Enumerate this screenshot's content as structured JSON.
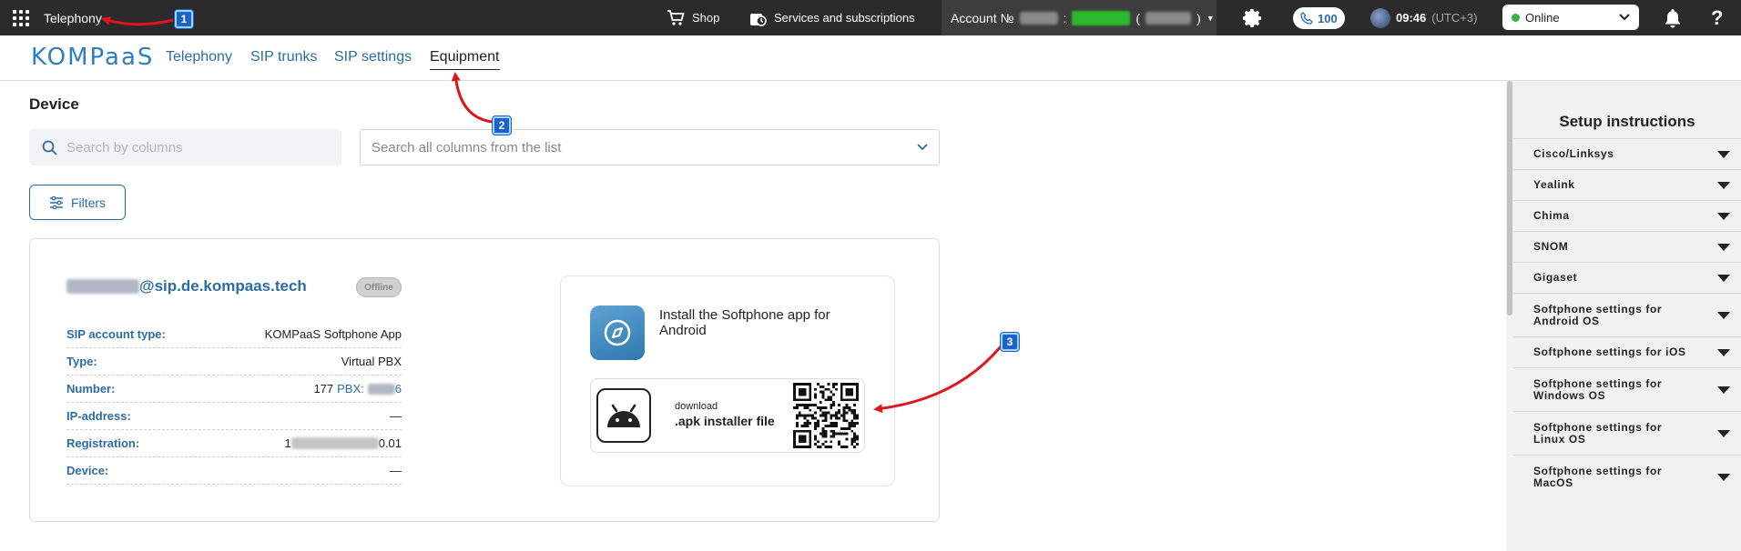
{
  "topbar": {
    "title": "Telephony",
    "shop_label": "Shop",
    "services_label": "Services and subscriptions",
    "account_prefix": "Account №",
    "account_sep": ":",
    "account_paren_open": "(",
    "account_paren_close": ")",
    "calls_count": "100",
    "time": "09:46",
    "timezone": "(UTC+3)",
    "status": "Online"
  },
  "subnav": {
    "logo": "KOMPaaS",
    "tabs": [
      {
        "label": "Telephony"
      },
      {
        "label": "SIP trunks"
      },
      {
        "label": "SIP settings"
      },
      {
        "label": "Equipment"
      }
    ]
  },
  "main": {
    "title": "Device",
    "search_placeholder": "Search by columns",
    "column_select": "Search all columns from the list",
    "filters_label": "Filters"
  },
  "device": {
    "sip_domain": "@sip.de.kompaas.tech",
    "status": "Offline",
    "props": [
      {
        "label": "SIP account type:",
        "value": "KOMPaaS Softphone App"
      },
      {
        "label": "Type:",
        "value": "Virtual PBX"
      },
      {
        "label": "Number:",
        "value": "177",
        "pbx_label": "PBX:",
        "pbx_suffix": "6"
      },
      {
        "label": "IP-address:",
        "value": "—"
      },
      {
        "label": "Registration:",
        "value_prefix": "1",
        "value_suffix": "0.01"
      },
      {
        "label": "Device:",
        "value": "—"
      }
    ]
  },
  "install": {
    "title": "Install the Softphone app for Android",
    "download_small": "download",
    "download_strong": ".apk installer file"
  },
  "side": {
    "title": "Setup instructions",
    "items": [
      "Cisco/Linksys",
      "Yealink",
      "Chima",
      "SNOM",
      "Gigaset",
      "Softphone settings for Android OS",
      "Softphone settings for iOS",
      "Softphone settings for Windows OS",
      "Softphone settings for Linux OS",
      "Softphone settings for MacOS"
    ]
  },
  "annotations": [
    "1",
    "2",
    "3"
  ],
  "colors": {
    "topbar": "#2b2b2b",
    "accent": "#2b6da3",
    "online": "#34b24a",
    "arrow": "#e0141c",
    "badge": "#1c63c9"
  },
  "icons": [
    "apps-grid-icon",
    "cart-icon",
    "services-icon",
    "gear-icon",
    "phone-icon",
    "bell-icon",
    "help-icon",
    "search-icon",
    "sliders-icon",
    "compass-icon",
    "android-icon",
    "qr-code-icon"
  ]
}
